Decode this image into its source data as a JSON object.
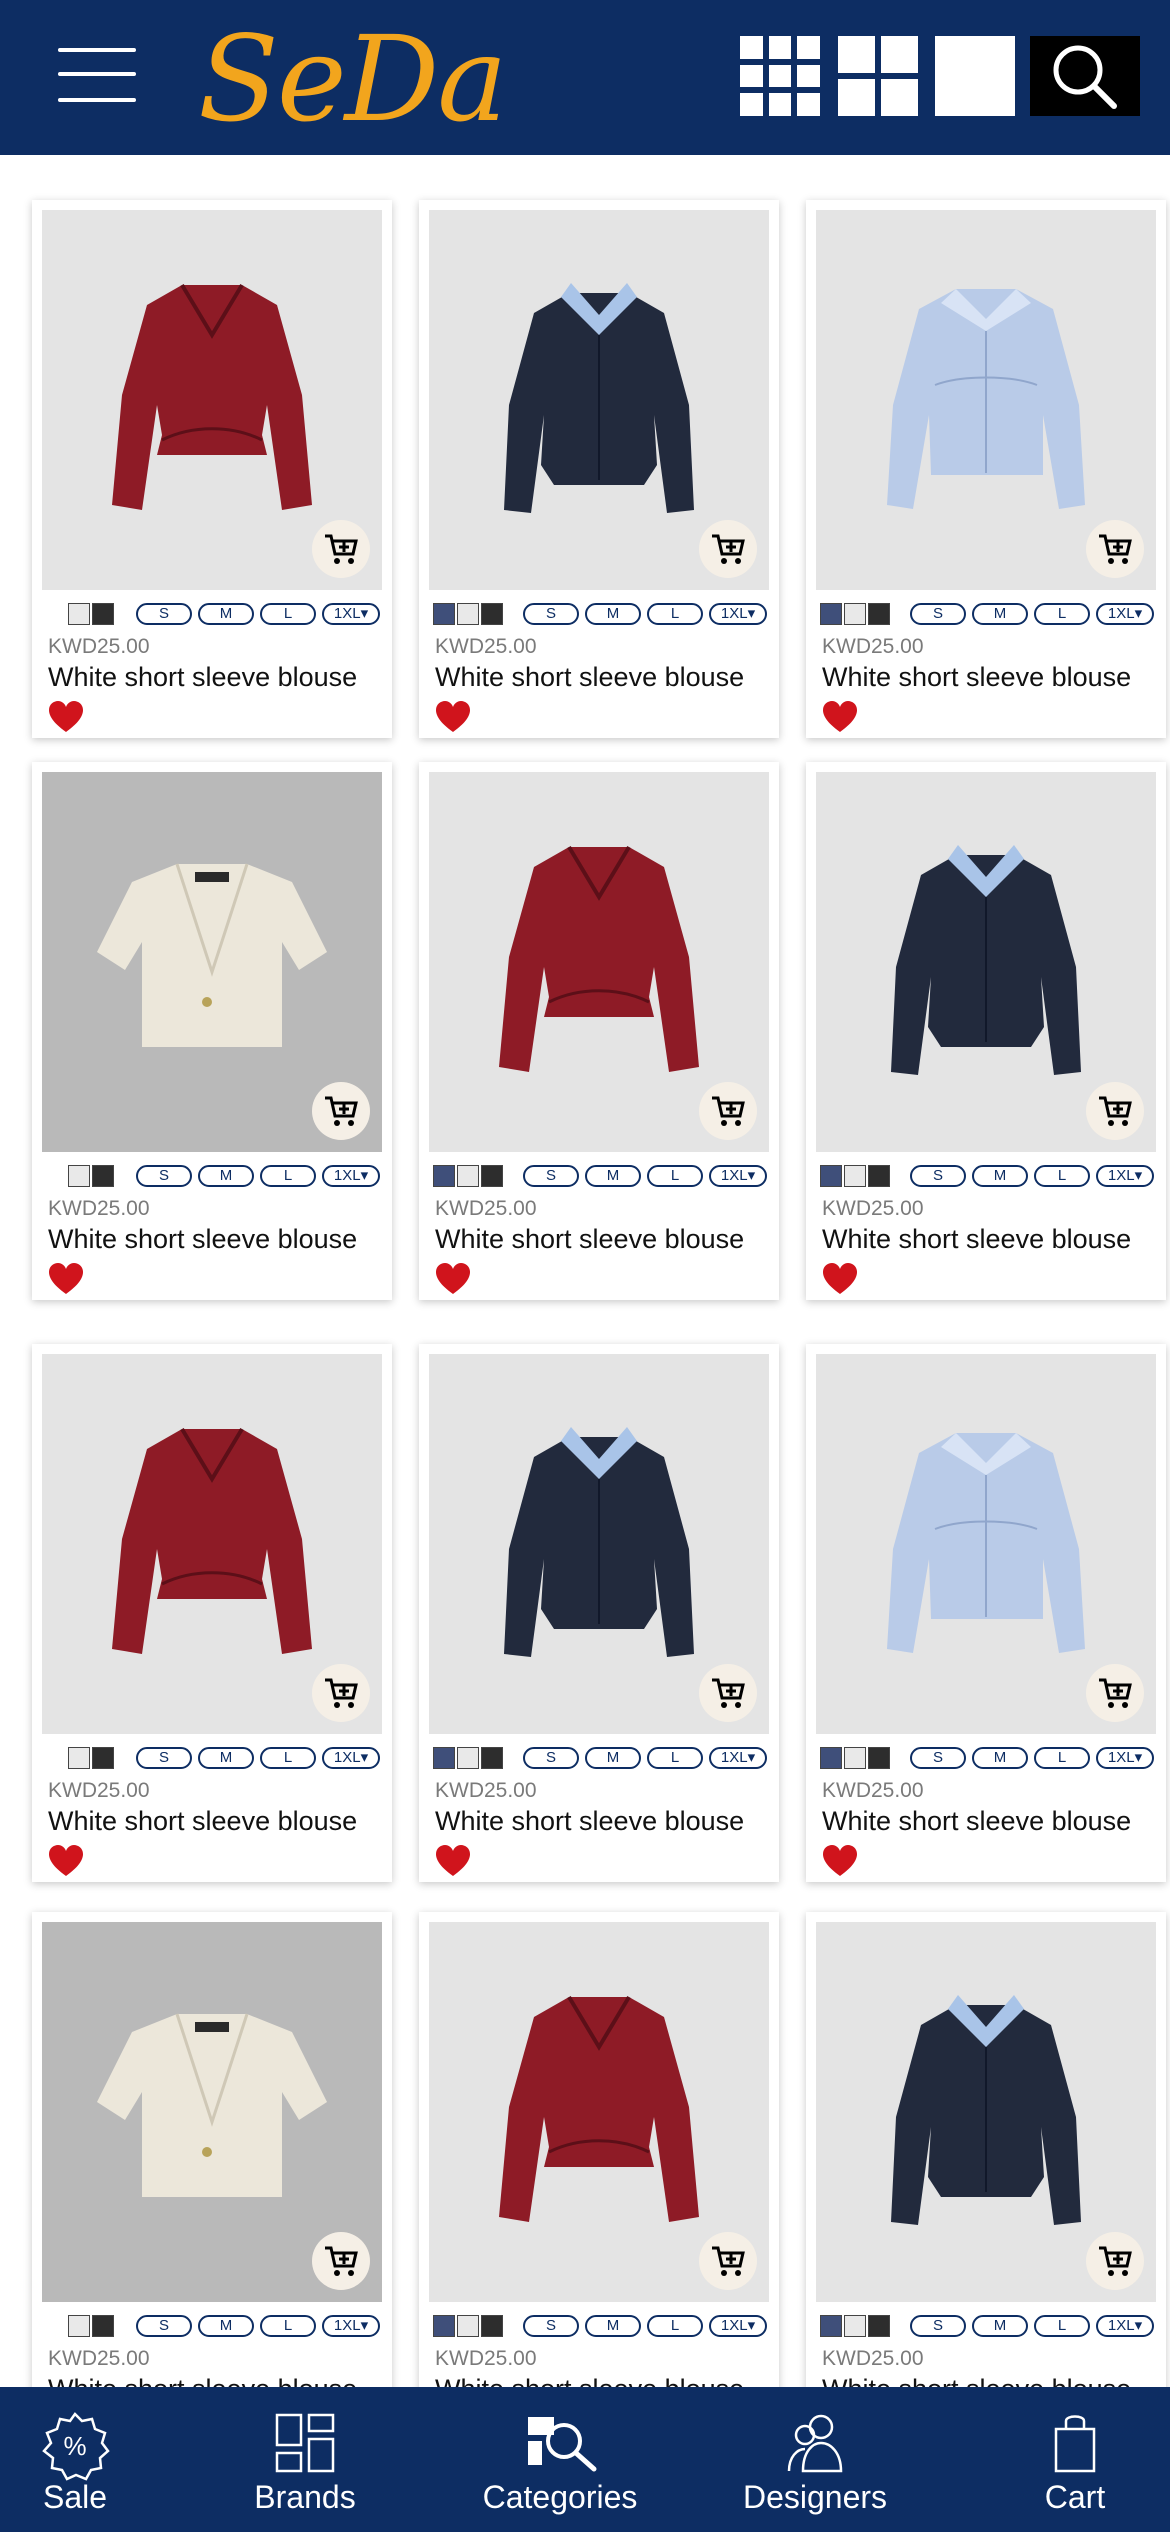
{
  "header": {
    "brand": "SeDa",
    "menu_icon": "hamburger-menu-icon",
    "view_options": [
      "grid-3x3-icon",
      "grid-2x2-icon",
      "grid-1-icon"
    ],
    "search_icon": "search-icon",
    "colors": {
      "primary": "#0d2d63",
      "brand_gold": "#f2a51d"
    }
  },
  "products": [
    {
      "price": "KWD25.00",
      "name": "White short sleeve blouse",
      "image": "burgundy-blouse",
      "swatches": [
        "#e9e9e9",
        "#2d2d2d"
      ],
      "sizes": [
        "S",
        "M",
        "L",
        "1XL▾"
      ]
    },
    {
      "price": "KWD25.00",
      "name": "White short sleeve blouse",
      "image": "navy-cardigan",
      "swatches": [
        "#3f4f7a",
        "#e9e9e9",
        "#2d2d2d"
      ],
      "sizes": [
        "S",
        "M",
        "L",
        "1XL▾"
      ]
    },
    {
      "price": "KWD25.00",
      "name": "White short sleeve blouse",
      "image": "lightblue-shirt",
      "swatches": [
        "#3f4f7a",
        "#e9e9e9",
        "#2d2d2d"
      ],
      "sizes": [
        "S",
        "M",
        "L",
        "1XL▾"
      ]
    },
    {
      "price": "KWD25.00",
      "name": "White short sleeve blouse",
      "image": "cream-blazer",
      "swatches": [
        "#e9e9e9",
        "#2d2d2d"
      ],
      "sizes": [
        "S",
        "M",
        "L",
        "1XL▾"
      ]
    },
    {
      "price": "KWD25.00",
      "name": "White short sleeve blouse",
      "image": "burgundy-blouse",
      "swatches": [
        "#3f4f7a",
        "#e9e9e9",
        "#2d2d2d"
      ],
      "sizes": [
        "S",
        "M",
        "L",
        "1XL▾"
      ]
    },
    {
      "price": "KWD25.00",
      "name": "White short sleeve blouse",
      "image": "navy-cardigan",
      "swatches": [
        "#3f4f7a",
        "#e9e9e9",
        "#2d2d2d"
      ],
      "sizes": [
        "S",
        "M",
        "L",
        "1XL▾"
      ]
    },
    {
      "price": "KWD25.00",
      "name": "White short sleeve blouse",
      "image": "burgundy-blouse",
      "swatches": [
        "#e9e9e9",
        "#2d2d2d"
      ],
      "sizes": [
        "S",
        "M",
        "L",
        "1XL▾"
      ]
    },
    {
      "price": "KWD25.00",
      "name": "White short sleeve blouse",
      "image": "navy-cardigan",
      "swatches": [
        "#3f4f7a",
        "#e9e9e9",
        "#2d2d2d"
      ],
      "sizes": [
        "S",
        "M",
        "L",
        "1XL▾"
      ]
    },
    {
      "price": "KWD25.00",
      "name": "White short sleeve blouse",
      "image": "lightblue-shirt",
      "swatches": [
        "#3f4f7a",
        "#e9e9e9",
        "#2d2d2d"
      ],
      "sizes": [
        "S",
        "M",
        "L",
        "1XL▾"
      ]
    },
    {
      "price": "KWD25.00",
      "name": "White short sleeve blouse",
      "image": "cream-blazer",
      "swatches": [
        "#e9e9e9",
        "#2d2d2d"
      ],
      "sizes": [
        "S",
        "M",
        "L",
        "1XL▾"
      ]
    },
    {
      "price": "KWD25.00",
      "name": "White short sleeve blouse",
      "image": "burgundy-blouse",
      "swatches": [
        "#3f4f7a",
        "#e9e9e9",
        "#2d2d2d"
      ],
      "sizes": [
        "S",
        "M",
        "L",
        "1XL▾"
      ]
    },
    {
      "price": "KWD25.00",
      "name": "White short sleeve blouse",
      "image": "navy-cardigan",
      "swatches": [
        "#3f4f7a",
        "#e9e9e9",
        "#2d2d2d"
      ],
      "sizes": [
        "S",
        "M",
        "L",
        "1XL▾"
      ]
    }
  ],
  "bottom_nav": [
    {
      "label": "Sale",
      "icon": "sale-badge-icon"
    },
    {
      "label": "Brands",
      "icon": "brands-grid-icon"
    },
    {
      "label": "Categories",
      "icon": "categories-search-icon"
    },
    {
      "label": "Designers",
      "icon": "designers-people-icon"
    },
    {
      "label": "Cart",
      "icon": "shopping-bag-icon"
    }
  ]
}
